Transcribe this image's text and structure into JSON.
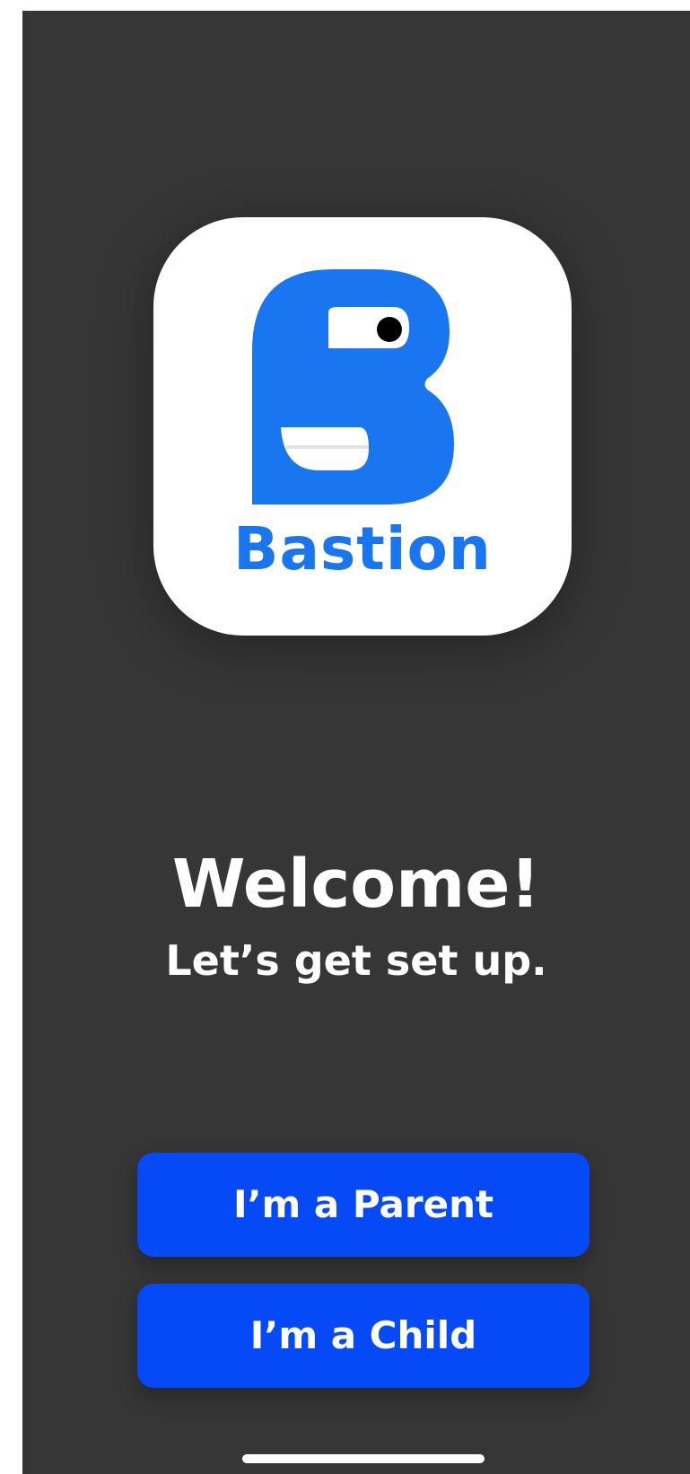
{
  "app": {
    "logo_text": "Bastion",
    "accent_color": "#1a75f0"
  },
  "welcome": {
    "title": "Welcome!",
    "subtitle": "Let’s get set up."
  },
  "actions": {
    "parent_label": "I’m a Parent",
    "child_label": "I’m a Child",
    "button_color": "#0549f7"
  },
  "icons": [
    "bastion-logo-icon",
    "home-indicator"
  ]
}
